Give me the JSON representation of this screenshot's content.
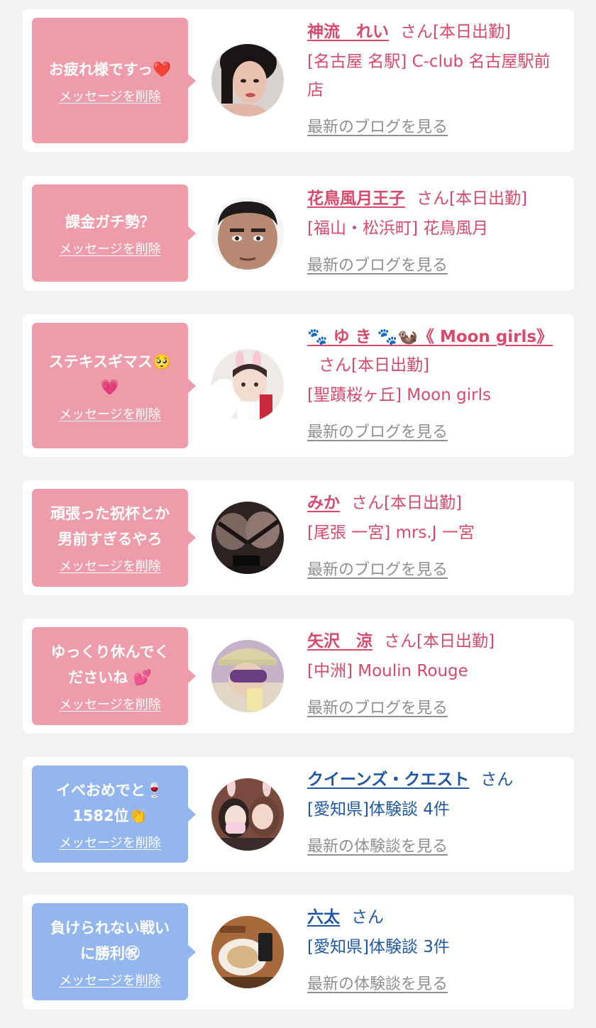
{
  "colors": {
    "pink_bubble": "#ee9caa",
    "blue_bubble": "#93b6ee",
    "cast_name": "#d9496b",
    "user_name": "#1f57a5",
    "link_gray": "#8f8f8f"
  },
  "messages": [
    {
      "type": "cast",
      "bubble_text": "お疲れ様ですっ❤️",
      "delete_label": "メッセージを削除",
      "name": "神流　れい",
      "suffix": "さん[本日出勤]",
      "location": "[名古屋 名駅] C-club 名古屋駅前店",
      "blog_label": "最新のブログを見る"
    },
    {
      "type": "cast",
      "bubble_text": "課金ガチ勢？",
      "delete_label": "メッセージを削除",
      "name": "花鳥風月王子",
      "suffix": "さん[本日出勤]",
      "location": "[福山・松浜町] 花鳥風月",
      "blog_label": "最新のブログを見る"
    },
    {
      "type": "cast",
      "bubble_text": "ステキスギマス🥺\n💗",
      "delete_label": "メッセージを削除",
      "name": "🐾 ゆ き 🐾🦦《 Moon girls》",
      "suffix": "さん[本日出勤]",
      "location": "[聖蹟桜ヶ丘] Moon girls",
      "blog_label": "最新のブログを見る"
    },
    {
      "type": "cast",
      "bubble_text": "頑張った祝杯とか\n男前すぎるやろ",
      "delete_label": "メッセージを削除",
      "name": "みか",
      "suffix": "さん[本日出勤]",
      "location": "[尾張 一宮] mrs.J 一宮",
      "blog_label": "最新のブログを見る"
    },
    {
      "type": "cast",
      "bubble_text": "ゆっくり休んでく\nださいね 💕",
      "delete_label": "メッセージを削除",
      "name": "矢沢　涼",
      "suffix": "さん[本日出勤]",
      "location": "[中洲] Moulin Rouge",
      "blog_label": "最新のブログを見る"
    },
    {
      "type": "user",
      "bubble_text": "イベおめでと🍷\n1582位👏",
      "delete_label": "メッセージを削除",
      "name": "クイーンズ・クエスト",
      "suffix": "さん",
      "location": "[愛知県]体験談 4件",
      "blog_label": "最新の体験談を見る"
    },
    {
      "type": "user",
      "bubble_text": "負けられない戦い\nに勝利㊗",
      "delete_label": "メッセージを削除",
      "name": "六太",
      "suffix": "さん",
      "location": "[愛知県]体験談 3件",
      "blog_label": "最新の体験談を見る"
    }
  ]
}
